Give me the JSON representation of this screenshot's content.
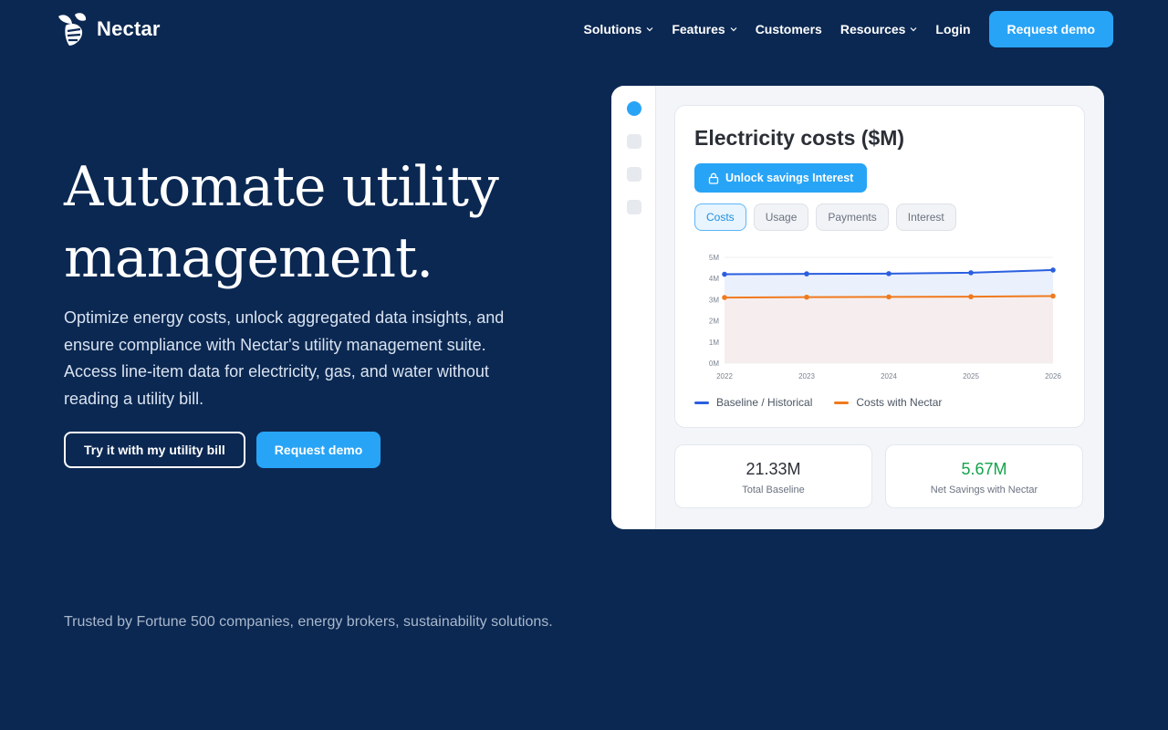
{
  "brand": {
    "name": "Nectar",
    "logo_icon": "bee-icon"
  },
  "nav": {
    "items": [
      {
        "label": "Solutions",
        "dropdown": true
      },
      {
        "label": "Features",
        "dropdown": true
      },
      {
        "label": "Customers",
        "dropdown": false
      },
      {
        "label": "Resources",
        "dropdown": true
      },
      {
        "label": "Login",
        "dropdown": false
      }
    ],
    "cta_label": "Request demo"
  },
  "hero": {
    "title_line1": "Automate utility",
    "title_line2": "management.",
    "subtitle": "Optimize energy costs, unlock aggregated data insights, and ensure compliance with Nectar's utility management suite. Access line-item data for electricity, gas, and water without reading a utility bill.",
    "primary_button": "Try it with my utility bill",
    "secondary_button": "Request demo"
  },
  "trusted_text": "Trusted by Fortune 500 companies, energy brokers, sustainability solutions.",
  "dashboard": {
    "title": "Electricity costs ($M)",
    "unlock_button": "Unlock savings Interest",
    "tabs": [
      "Costs",
      "Usage",
      "Payments",
      "Interest"
    ],
    "active_tab": "Costs",
    "stats": [
      {
        "value": "21.33M",
        "label": "Total Baseline",
        "color": "#2b2f36"
      },
      {
        "value": "5.67M",
        "label": "Net Savings with Nectar",
        "color": "#14a34a"
      }
    ]
  },
  "colors": {
    "accent": "#28a4f7",
    "background": "#0b2852",
    "baseline": "#2b5fe0",
    "nectar": "#f07a1f",
    "savings": "#14a34a"
  },
  "chart_data": {
    "type": "area",
    "title": "Electricity costs ($M)",
    "x": [
      "2022",
      "2023",
      "2024",
      "2025",
      "2026"
    ],
    "ylim": [
      0,
      5
    ],
    "yticks": [
      "0M",
      "1M",
      "2M",
      "3M",
      "4M",
      "5M"
    ],
    "grid": true,
    "legend_position": "bottom-left",
    "series": [
      {
        "name": "Baseline / Historical",
        "values": [
          4.2,
          4.22,
          4.23,
          4.27,
          4.4
        ],
        "color": "#2b5fe0"
      },
      {
        "name": "Costs with Nectar",
        "values": [
          3.1,
          3.12,
          3.13,
          3.14,
          3.17
        ],
        "color": "#f07a1f"
      }
    ]
  }
}
